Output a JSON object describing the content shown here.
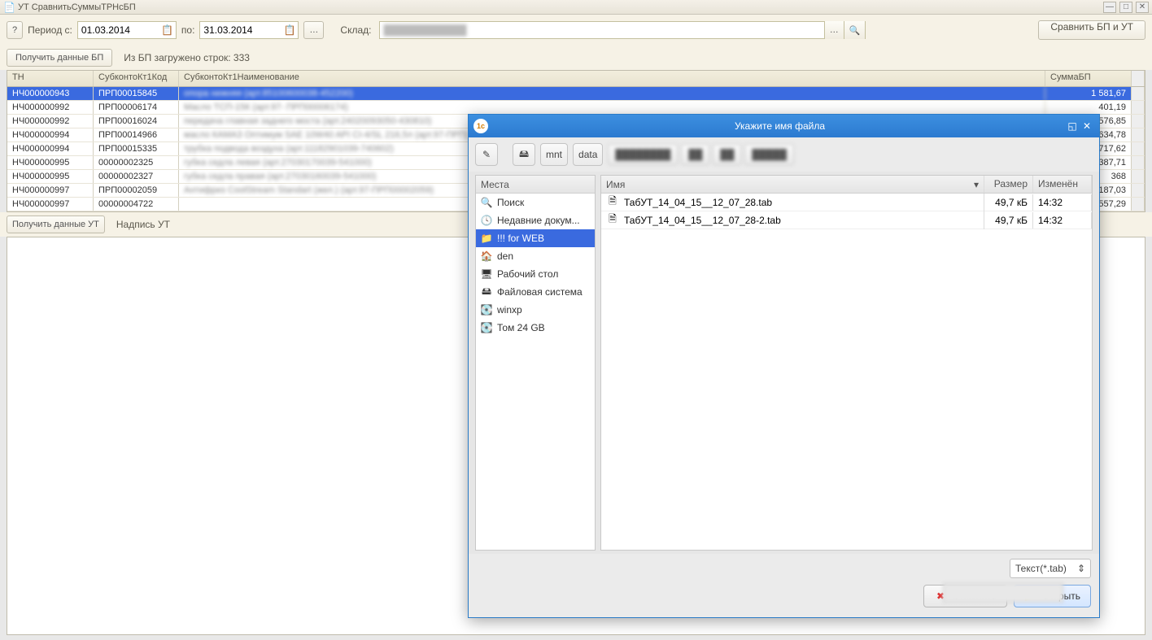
{
  "window": {
    "title": "УТ СравнитьСуммыТРНсБП"
  },
  "toolbar": {
    "help": "?",
    "period_from_label": "Период с:",
    "period_from": "01.03.2014",
    "period_to_label": "по:",
    "period_to": "31.03.2014",
    "sklad_label": "Склад:",
    "sklad_value": "",
    "compare_btn": "Сравнить БП и УТ"
  },
  "bp_bar": {
    "load_btn": "Получить данные БП",
    "status": "Из БП загружено строк: 333"
  },
  "grid": {
    "headers": {
      "tn": "ТН",
      "code": "СубконтоКт1Код",
      "name": "СубконтоКт1Наименование",
      "sum": "СуммаБП"
    },
    "rows": [
      {
        "tn": "НЧ000000943",
        "code": "ПРП00015845",
        "name": "опора нижняя (арт.85100600038-452200)",
        "sum": "1 581,67"
      },
      {
        "tn": "НЧ000000992",
        "code": "ПРП00006174",
        "name": "Масло ТСП-15К (арт.97- ПРП00006174)",
        "sum": "401,19"
      },
      {
        "tn": "НЧ000000992",
        "code": "ПРП00016024",
        "name": "передача главная заднего моста (арт.24020093050-430810)",
        "sum": "576,85"
      },
      {
        "tn": "НЧ000000994",
        "code": "ПРП00014966",
        "name": "масло КАМАЗ Оптимум SAE 10W40 API CI-4/SL 216,5л (арт.97-ПРП)",
        "sum": "634,78"
      },
      {
        "tn": "НЧ000000994",
        "code": "ПРП00015335",
        "name": "трубка подвода воздуха (арт.11182901039-740602)",
        "sum": "717,62"
      },
      {
        "tn": "НЧ000000995",
        "code": "00000002325",
        "name": "губка седла левая (арт.27030170039-541000)",
        "sum": "387,71"
      },
      {
        "tn": "НЧ000000995",
        "code": "00000002327",
        "name": "губка седла правая (арт.27030160039-541000)",
        "sum": "368"
      },
      {
        "tn": "НЧ000000997",
        "code": "ПРП00002059",
        "name": "Антифриз CoolStream Standart (жел.) (арт.97-ПРП00002059)",
        "sum": "187,03"
      },
      {
        "tn": "НЧ000000997",
        "code": "00000004722",
        "name": "",
        "sum": "557,29"
      }
    ]
  },
  "ut_bar": {
    "load_btn": "Получить данные УТ",
    "label": "Надпись УТ"
  },
  "dialog": {
    "title": "Укажите имя файла",
    "path_buttons": [
      "mnt",
      "data"
    ],
    "places_header": "Места",
    "places": [
      {
        "icon": "search",
        "label": "Поиск"
      },
      {
        "icon": "clock",
        "label": "Недавние докум..."
      },
      {
        "icon": "folder",
        "label": "!!! for WEB",
        "selected": true
      },
      {
        "icon": "home",
        "label": "den"
      },
      {
        "icon": "desktop",
        "label": "Рабочий стол"
      },
      {
        "icon": "fs",
        "label": "Файловая система"
      },
      {
        "icon": "disk",
        "label": "winxp"
      },
      {
        "icon": "disk",
        "label": "Том 24 GB"
      }
    ],
    "file_headers": {
      "name": "Имя",
      "size": "Размер",
      "modified": "Изменён"
    },
    "files": [
      {
        "name": "ТабУТ_14_04_15__12_07_28.tab",
        "size": "49,7 кБ",
        "modified": "14:32"
      },
      {
        "name": "ТабУТ_14_04_15__12_07_28-2.tab",
        "size": "49,7 кБ",
        "modified": "14:32"
      }
    ],
    "filetype": "Текст(*.tab)",
    "cancel": "Отменить",
    "open": "Открыть"
  }
}
